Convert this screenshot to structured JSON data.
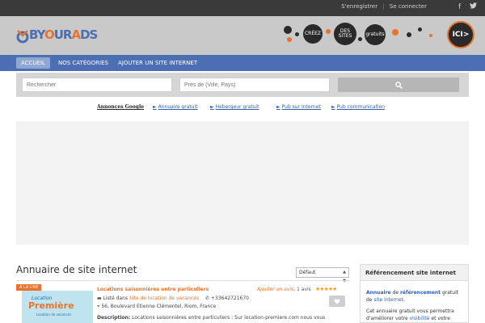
{
  "topbar": {
    "register": "S'enregistrer",
    "separator": "|",
    "login": "Se connecter",
    "social": [
      "facebook-icon",
      "twitter-icon"
    ]
  },
  "header": {
    "logo_text": [
      "B",
      "Y",
      "O",
      "U",
      "R",
      "A",
      "D",
      "S"
    ],
    "banner": {
      "bubbles": [
        "CRÉEZ",
        "DES SITES",
        "gratuits",
        "ICI>"
      ]
    }
  },
  "nav": {
    "items": [
      "ACCUEIL",
      "NOS CATÉGORIES",
      "AJOUTER UN SITE INTERNET"
    ]
  },
  "search": {
    "query_placeholder": "Rechercher",
    "location_placeholder": "Près de (Ville, Pays)",
    "button_icon": "search-icon"
  },
  "ads": {
    "label": "Annonces Google",
    "links": [
      "Annuaire gratuit",
      "Hebergeur gratuit",
      "Pub sur Internet",
      "Pub communication"
    ]
  },
  "main": {
    "title": "Annuaire de site internet",
    "sort": {
      "selected": "Défaut"
    }
  },
  "listing": {
    "ribbon": "A LA UNE",
    "thumb_lines": [
      "Location",
      "Première",
      "Location de vacances"
    ],
    "title": "Locations saisonnières entre particuliers",
    "add_review": "Ajouter un avis",
    "separator": ",",
    "reviews": "1 avis",
    "rating": 5,
    "listed_prefix": "Listé dans",
    "category": "Site de location de vacances",
    "phone": "+33642721670",
    "address": "56, Boulevard Etienne Clémentel, Riom, France",
    "description_label": "Description:",
    "description": "Locations saisonnières entre particuliers : Sur location-premiere.com nous vous"
  },
  "sidebar": {
    "title": "Référencement site internet",
    "p1": [
      "Annuaire",
      "de",
      "référencement",
      "gratuit de",
      "site internet",
      "."
    ],
    "p2": [
      "Cet annuaire gratuit vous permettra d'améliorer votre",
      "visibilité",
      "et votre"
    ]
  },
  "colors": {
    "accent": "#e8732c",
    "nav": "#4b6fb2",
    "topbar": "#3a3a3a",
    "link": "#2b5fb0"
  }
}
